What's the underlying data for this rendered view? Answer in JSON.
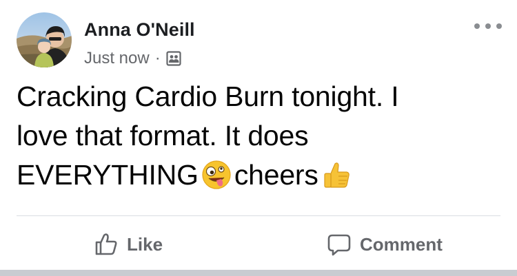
{
  "post": {
    "author_name": "Anna O'Neill",
    "timestamp": "Just now",
    "separator": "·",
    "audience_icon": "friends-icon",
    "text_lines": [
      "Cracking Cardio Burn tonight. I",
      "love that format. It does",
      "EVERYTHING"
    ],
    "text_tail": "cheers",
    "emojis": [
      "zany-face-emoji",
      "thumbs-up-emoji"
    ]
  },
  "actions": {
    "like_label": "Like",
    "comment_label": "Comment"
  },
  "colors": {
    "secondary_text": "#65676b",
    "divider": "#dadde1",
    "bottom_bar": "#c9ccd1"
  }
}
